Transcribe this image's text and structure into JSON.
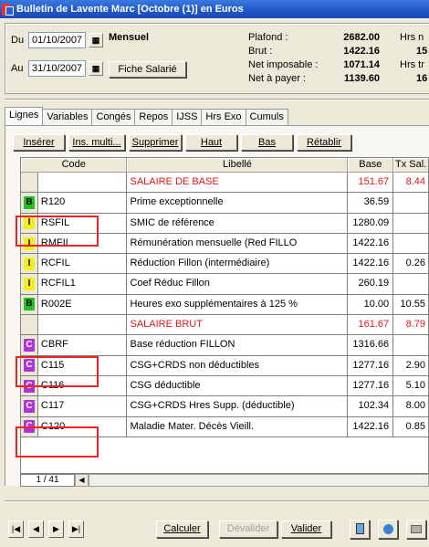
{
  "window": {
    "title": "Bulletin de Lavente Marc  [Octobre (1)] en Euros"
  },
  "period": {
    "from_label": "Du",
    "from_value": "01/10/2007",
    "to_label": "Au",
    "to_value": "31/10/2007",
    "type_label": "Mensuel",
    "fiche_button": "Fiche Salarié"
  },
  "summary": {
    "plafond_label": "Plafond :",
    "plafond_value": "2682.00",
    "brut_label": "Brut :",
    "brut_value": "1422.16",
    "imposable_label": "Net imposable :",
    "imposable_value": "1071.14",
    "apayer_label": "Net à payer :",
    "apayer_value": "1139.60",
    "hrs1_label": "Hrs n",
    "hrs1_value": "15",
    "hrs2_label": "Hrs tr",
    "hrs2_value": "16"
  },
  "tabs": [
    "Lignes",
    "Variables",
    "Congés",
    "Repos",
    "IJSS",
    "Hrs Exo",
    "Cumuls"
  ],
  "toolbar": {
    "inserer": "Insérer",
    "ins_multi": "Ins. multi...",
    "supprimer": "Supprimer",
    "haut": "Haut",
    "bas": "Bas",
    "retablir": "Rétablir"
  },
  "table": {
    "headers": [
      "Code",
      "Libellé",
      "Base",
      "Tx Sal."
    ],
    "rows": [
      {
        "icon": "",
        "code": "",
        "libelle": "SALAIRE DE BASE",
        "base": "151.67",
        "tx": "8.44",
        "red": true
      },
      {
        "icon": "B",
        "code": "R120",
        "libelle": "Prime exceptionnelle",
        "base": "36.59",
        "tx": "",
        "red": false
      },
      {
        "icon": "I",
        "code": "RSFIL",
        "libelle": "SMIC de référence",
        "base": "1280.09",
        "tx": "",
        "red": false
      },
      {
        "icon": "I",
        "code": "RMFIL",
        "libelle": "Rémunération mensuelle (Red FILLO",
        "base": "1422.16",
        "tx": "",
        "red": false
      },
      {
        "icon": "I",
        "code": "RCFIL",
        "libelle": "Réduction Fillon (intermédiaire)",
        "base": "1422.16",
        "tx": "0.26",
        "red": false
      },
      {
        "icon": "I",
        "code": "RCFIL1",
        "libelle": "Coef Réduc Fillon",
        "base": "260.19",
        "tx": "",
        "red": false
      },
      {
        "icon": "B",
        "code": "R002E",
        "libelle": "Heures exo supplémentaires à 125 %",
        "base": "10.00",
        "tx": "10.55",
        "red": false
      },
      {
        "icon": "",
        "code": "",
        "libelle": "SALAIRE BRUT",
        "base": "161.67",
        "tx": "8.79",
        "red": true
      },
      {
        "icon": "C",
        "code": "CBRF",
        "libelle": "Base réduction FILLON",
        "base": "1316.66",
        "tx": "",
        "red": false
      },
      {
        "icon": "C",
        "code": "C115",
        "libelle": "CSG+CRDS non déductibles",
        "base": "1277.16",
        "tx": "2.90",
        "red": false
      },
      {
        "icon": "C",
        "code": "C116",
        "libelle": "CSG déductible",
        "base": "1277.16",
        "tx": "5.10",
        "red": false
      },
      {
        "icon": "C",
        "code": "C117",
        "libelle": "CSG+CRDS Hres Supp. (déductible)",
        "base": "102.34",
        "tx": "8.00",
        "red": false
      },
      {
        "icon": "C",
        "code": "C120",
        "libelle": "Maladie Mater. Décès Vieill.",
        "base": "1422.16",
        "tx": "0.85",
        "red": false
      }
    ]
  },
  "pager": {
    "label": "1 / 41"
  },
  "bottom": {
    "calculer": "Calculer",
    "devalider": "Dévalider",
    "valider": "Valider"
  },
  "colors": {
    "accent_red": "#e51414",
    "title_blue": "#1f57c7"
  }
}
